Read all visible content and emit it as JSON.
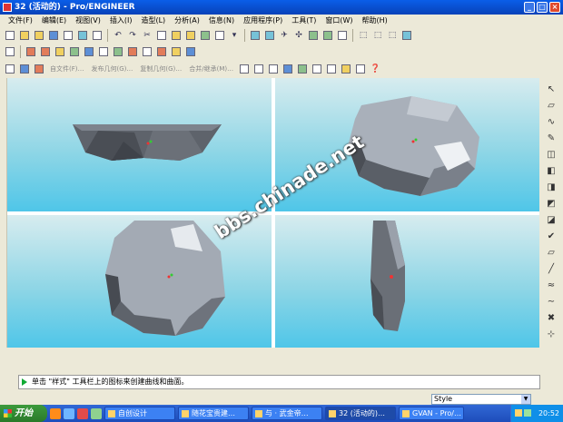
{
  "window": {
    "title": "32 (活动的) - Pro/ENGINEER"
  },
  "menu": [
    "文件(F)",
    "编辑(E)",
    "视图(V)",
    "插入(I)",
    "造型(L)",
    "分析(A)",
    "信息(N)",
    "应用程序(P)",
    "工具(T)",
    "窗口(W)",
    "帮助(H)"
  ],
  "toolbar3_labels": [
    "自文件(F)…",
    "发布几何(G)…",
    "复制几何(G)…",
    "合并/继承(M)…"
  ],
  "watermark": "bbs.chinade.net",
  "message": "单击 \"样式\" 工具栏上的图标来创建曲线和曲面。",
  "style_combo": "Style",
  "taskbar": {
    "start": "开始",
    "buttons": [
      "自创设计",
      "随花宝贵建…",
      "与 · 武金帝…",
      "32 (活动的)…",
      "GVAN - Pro/…"
    ],
    "active_index": 3,
    "clock": "20:52"
  },
  "colors": {
    "titlebar": "#0a5ee8",
    "viewport_top": "#d7ecef",
    "viewport_bottom": "#4fc6e8",
    "taskbar": "#3168d5"
  }
}
